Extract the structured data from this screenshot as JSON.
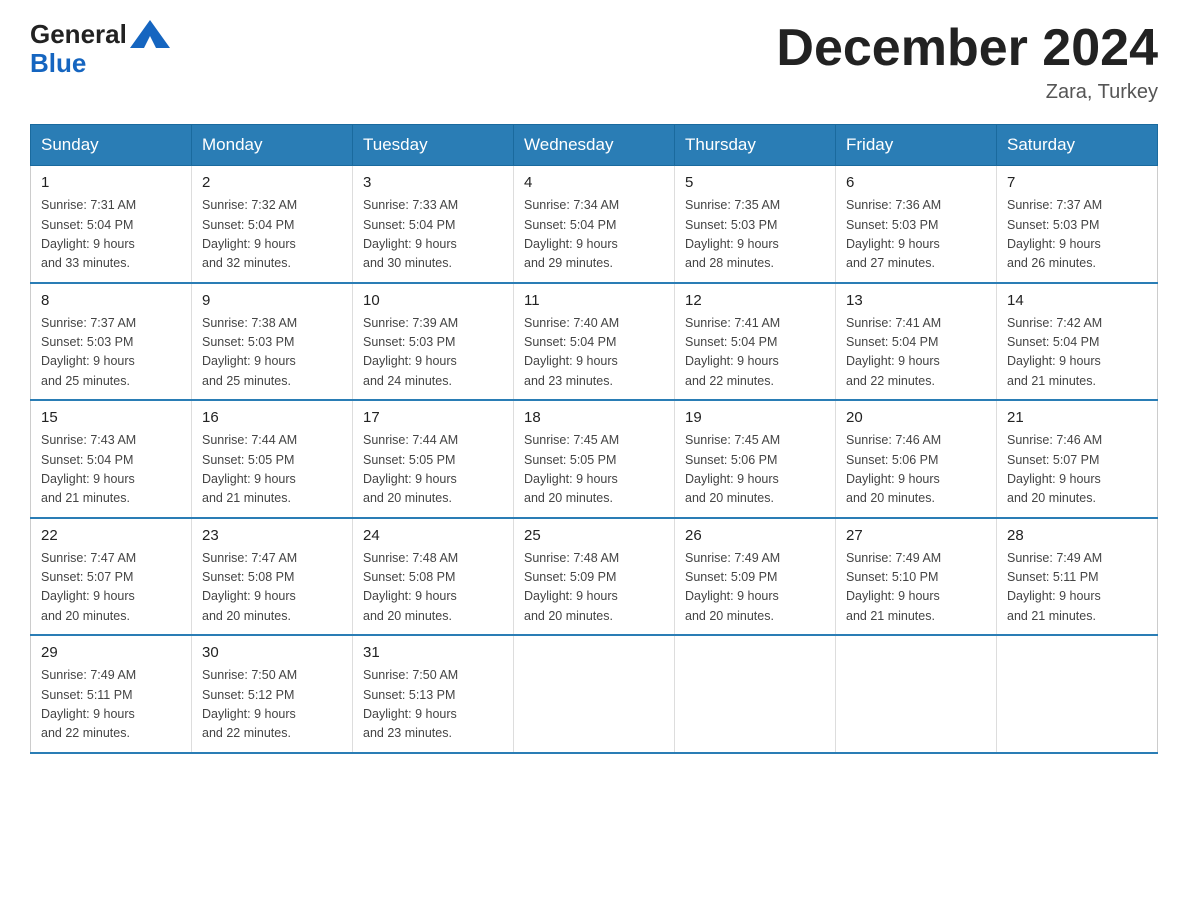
{
  "header": {
    "logo_general": "General",
    "logo_blue": "Blue",
    "month_title": "December 2024",
    "location": "Zara, Turkey"
  },
  "days_of_week": [
    "Sunday",
    "Monday",
    "Tuesday",
    "Wednesday",
    "Thursday",
    "Friday",
    "Saturday"
  ],
  "weeks": [
    [
      {
        "num": "1",
        "sunrise": "7:31 AM",
        "sunset": "5:04 PM",
        "daylight": "9 hours and 33 minutes."
      },
      {
        "num": "2",
        "sunrise": "7:32 AM",
        "sunset": "5:04 PM",
        "daylight": "9 hours and 32 minutes."
      },
      {
        "num": "3",
        "sunrise": "7:33 AM",
        "sunset": "5:04 PM",
        "daylight": "9 hours and 30 minutes."
      },
      {
        "num": "4",
        "sunrise": "7:34 AM",
        "sunset": "5:04 PM",
        "daylight": "9 hours and 29 minutes."
      },
      {
        "num": "5",
        "sunrise": "7:35 AM",
        "sunset": "5:03 PM",
        "daylight": "9 hours and 28 minutes."
      },
      {
        "num": "6",
        "sunrise": "7:36 AM",
        "sunset": "5:03 PM",
        "daylight": "9 hours and 27 minutes."
      },
      {
        "num": "7",
        "sunrise": "7:37 AM",
        "sunset": "5:03 PM",
        "daylight": "9 hours and 26 minutes."
      }
    ],
    [
      {
        "num": "8",
        "sunrise": "7:37 AM",
        "sunset": "5:03 PM",
        "daylight": "9 hours and 25 minutes."
      },
      {
        "num": "9",
        "sunrise": "7:38 AM",
        "sunset": "5:03 PM",
        "daylight": "9 hours and 25 minutes."
      },
      {
        "num": "10",
        "sunrise": "7:39 AM",
        "sunset": "5:03 PM",
        "daylight": "9 hours and 24 minutes."
      },
      {
        "num": "11",
        "sunrise": "7:40 AM",
        "sunset": "5:04 PM",
        "daylight": "9 hours and 23 minutes."
      },
      {
        "num": "12",
        "sunrise": "7:41 AM",
        "sunset": "5:04 PM",
        "daylight": "9 hours and 22 minutes."
      },
      {
        "num": "13",
        "sunrise": "7:41 AM",
        "sunset": "5:04 PM",
        "daylight": "9 hours and 22 minutes."
      },
      {
        "num": "14",
        "sunrise": "7:42 AM",
        "sunset": "5:04 PM",
        "daylight": "9 hours and 21 minutes."
      }
    ],
    [
      {
        "num": "15",
        "sunrise": "7:43 AM",
        "sunset": "5:04 PM",
        "daylight": "9 hours and 21 minutes."
      },
      {
        "num": "16",
        "sunrise": "7:44 AM",
        "sunset": "5:05 PM",
        "daylight": "9 hours and 21 minutes."
      },
      {
        "num": "17",
        "sunrise": "7:44 AM",
        "sunset": "5:05 PM",
        "daylight": "9 hours and 20 minutes."
      },
      {
        "num": "18",
        "sunrise": "7:45 AM",
        "sunset": "5:05 PM",
        "daylight": "9 hours and 20 minutes."
      },
      {
        "num": "19",
        "sunrise": "7:45 AM",
        "sunset": "5:06 PM",
        "daylight": "9 hours and 20 minutes."
      },
      {
        "num": "20",
        "sunrise": "7:46 AM",
        "sunset": "5:06 PM",
        "daylight": "9 hours and 20 minutes."
      },
      {
        "num": "21",
        "sunrise": "7:46 AM",
        "sunset": "5:07 PM",
        "daylight": "9 hours and 20 minutes."
      }
    ],
    [
      {
        "num": "22",
        "sunrise": "7:47 AM",
        "sunset": "5:07 PM",
        "daylight": "9 hours and 20 minutes."
      },
      {
        "num": "23",
        "sunrise": "7:47 AM",
        "sunset": "5:08 PM",
        "daylight": "9 hours and 20 minutes."
      },
      {
        "num": "24",
        "sunrise": "7:48 AM",
        "sunset": "5:08 PM",
        "daylight": "9 hours and 20 minutes."
      },
      {
        "num": "25",
        "sunrise": "7:48 AM",
        "sunset": "5:09 PM",
        "daylight": "9 hours and 20 minutes."
      },
      {
        "num": "26",
        "sunrise": "7:49 AM",
        "sunset": "5:09 PM",
        "daylight": "9 hours and 20 minutes."
      },
      {
        "num": "27",
        "sunrise": "7:49 AM",
        "sunset": "5:10 PM",
        "daylight": "9 hours and 21 minutes."
      },
      {
        "num": "28",
        "sunrise": "7:49 AM",
        "sunset": "5:11 PM",
        "daylight": "9 hours and 21 minutes."
      }
    ],
    [
      {
        "num": "29",
        "sunrise": "7:49 AM",
        "sunset": "5:11 PM",
        "daylight": "9 hours and 22 minutes."
      },
      {
        "num": "30",
        "sunrise": "7:50 AM",
        "sunset": "5:12 PM",
        "daylight": "9 hours and 22 minutes."
      },
      {
        "num": "31",
        "sunrise": "7:50 AM",
        "sunset": "5:13 PM",
        "daylight": "9 hours and 23 minutes."
      },
      null,
      null,
      null,
      null
    ]
  ],
  "labels": {
    "sunrise": "Sunrise:",
    "sunset": "Sunset:",
    "daylight": "Daylight:"
  }
}
